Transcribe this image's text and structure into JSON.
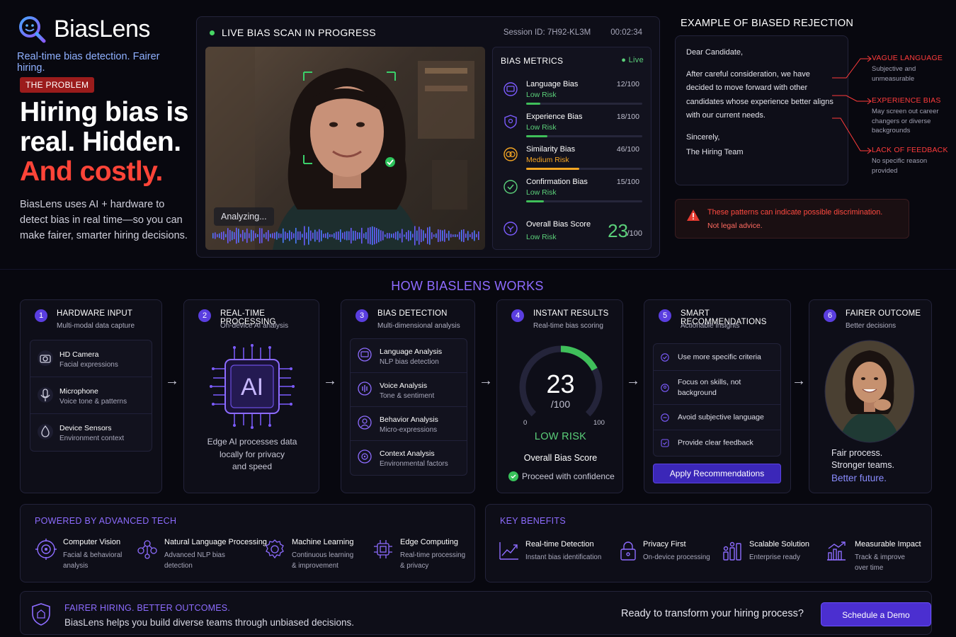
{
  "brand": {
    "name": "BiasLens",
    "tagline": "Real-time bias detection. Fairer hiring."
  },
  "problem": {
    "badge": "THE PROBLEM",
    "line1": "Hiring bias is",
    "line2": "real. Hidden.",
    "line3": "And costly.",
    "desc": "BiasLens uses AI + hardware to detect bias in real time—so you can make fairer, smarter hiring decisions."
  },
  "scan": {
    "title": "LIVE BIAS SCAN IN PROGRESS",
    "session": "Session ID: 7H92-KL3M",
    "timer": "00:02:34",
    "analyzing": "Analyzing..."
  },
  "metrics": {
    "title": "BIAS METRICS",
    "live": "Live",
    "items": [
      {
        "name": "Language Bias",
        "risk": "Low Risk",
        "score": "12/100",
        "value": 12,
        "color": "#3fbf5a",
        "icon": "language-icon"
      },
      {
        "name": "Experience Bias",
        "risk": "Low Risk",
        "score": "18/100",
        "value": 18,
        "color": "#3fbf5a",
        "icon": "experience-icon"
      },
      {
        "name": "Similarity Bias",
        "risk": "Medium Risk",
        "score": "46/100",
        "value": 46,
        "color": "#f5a623",
        "icon": "similarity-icon"
      },
      {
        "name": "Confirmation Bias",
        "risk": "Low Risk",
        "score": "15/100",
        "value": 15,
        "color": "#3fbf5a",
        "icon": "confirmation-icon"
      }
    ],
    "overall": {
      "name": "Overall Bias Score",
      "risk": "Low Risk",
      "score": "23",
      "denominator": "/100"
    }
  },
  "rejection": {
    "title": "EXAMPLE OF BIASED REJECTION",
    "greeting": "Dear Candidate,",
    "body": "After careful consideration, we have decided to move forward with other candidates whose experience better aligns with our current needs.",
    "signoff": "Sincerely,",
    "signature": "The Hiring Team",
    "flags": [
      {
        "title": "VAGUE LANGUAGE",
        "desc": "Subjective and unmeasurable"
      },
      {
        "title": "EXPERIENCE BIAS",
        "desc": "May screen out career changers or diverse backgrounds"
      },
      {
        "title": "LACK OF FEEDBACK",
        "desc": "No specific reason provided"
      }
    ],
    "warning": "These patterns can indicate possible discrimination.",
    "warning_sub": "Not legal advice."
  },
  "how": {
    "title": "HOW BIASLENS WORKS",
    "steps": [
      {
        "num": "1",
        "title": "HARDWARE INPUT",
        "sub": "Multi-modal data capture"
      },
      {
        "num": "2",
        "title": "REAL-TIME PROCESSING",
        "sub": "On-device AI analysis"
      },
      {
        "num": "3",
        "title": "BIAS DETECTION",
        "sub": "Multi-dimensional analysis"
      },
      {
        "num": "4",
        "title": "INSTANT RESULTS",
        "sub": "Real-time bias scoring"
      },
      {
        "num": "5",
        "title": "SMART RECOMMENDATIONS",
        "sub": "Actionable insights"
      },
      {
        "num": "6",
        "title": "FAIRER OUTCOME",
        "sub": "Better decisions"
      }
    ],
    "hardware": [
      {
        "title": "HD Camera",
        "desc": "Facial expressions"
      },
      {
        "title": "Microphone",
        "desc": "Voice tone & patterns"
      },
      {
        "title": "Device Sensors",
        "desc": "Environment context"
      }
    ],
    "ai": {
      "chip": "AI",
      "line1": "Edge AI processes data",
      "line2": "locally for privacy",
      "line3": "and speed"
    },
    "detection": [
      {
        "title": "Language Analysis",
        "desc": "NLP bias detection"
      },
      {
        "title": "Voice Analysis",
        "desc": "Tone & sentiment"
      },
      {
        "title": "Behavior Analysis",
        "desc": "Micro-expressions"
      },
      {
        "title": "Context Analysis",
        "desc": "Environmental factors"
      }
    ],
    "results": {
      "score": "23",
      "value": 23,
      "denominator": "/100",
      "min": "0",
      "max": "100",
      "risk": "LOW RISK",
      "label": "Overall Bias Score",
      "confirm": "Proceed with confidence"
    },
    "recs": [
      "Use more specific criteria",
      "Focus on skills, not background",
      "Avoid subjective language",
      "Provide clear feedback"
    ],
    "apply": "Apply Recommendations",
    "outcome": {
      "line1": "Fair process.",
      "line2": "Stronger teams.",
      "line3": "Better future."
    }
  },
  "tech": {
    "title": "POWERED BY ADVANCED TECH",
    "items": [
      {
        "title": "Computer Vision",
        "d1": "Facial & behavioral",
        "d2": "analysis"
      },
      {
        "title": "Natural Language Processing",
        "d1": "Advanced NLP bias",
        "d2": "detection"
      },
      {
        "title": "Machine Learning",
        "d1": "Continuous learning",
        "d2": "& improvement"
      },
      {
        "title": "Edge Computing",
        "d1": "Real-time processing",
        "d2": "& privacy"
      }
    ]
  },
  "benefits": {
    "title": "KEY BENEFITS",
    "items": [
      {
        "title": "Real-time Detection",
        "d1": "Instant bias identification",
        "d2": ""
      },
      {
        "title": "Privacy First",
        "d1": "On-device processing",
        "d2": ""
      },
      {
        "title": "Scalable Solution",
        "d1": "Enterprise ready",
        "d2": ""
      },
      {
        "title": "Measurable Impact",
        "d1": "Track & improve",
        "d2": "over time"
      }
    ]
  },
  "footer": {
    "title": "FAIRER HIRING. BETTER OUTCOMES.",
    "desc": "BiasLens helps you build diverse teams through unbiased decisions.",
    "cta": "Ready to transform your hiring process?",
    "button": "Schedule a Demo"
  }
}
